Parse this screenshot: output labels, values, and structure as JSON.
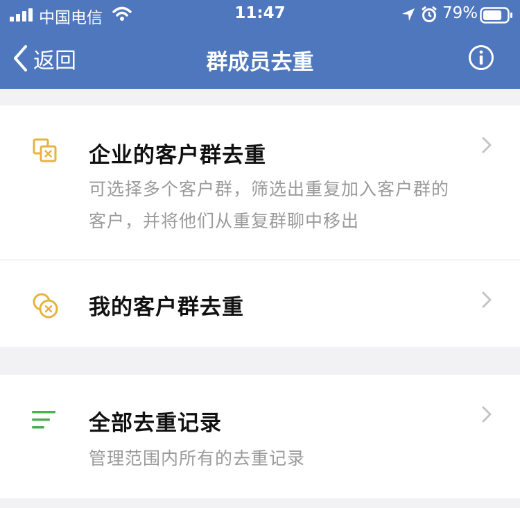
{
  "status_bar": {
    "carrier": "中国电信",
    "time": "11:47",
    "battery_percent": "79%",
    "battery_level": 0.79
  },
  "nav": {
    "back_label": "返回",
    "title": "群成员去重"
  },
  "rows": [
    {
      "title": "企业的客户群去重",
      "desc": "可选择多个客户群，筛选出重复加入客户群的客户，并将他们从重复群聊中移出",
      "icon": "overlap-squares-icon"
    },
    {
      "title": "我的客户群去重",
      "icon": "overlap-circles-icon"
    },
    {
      "title": "全部去重记录",
      "desc": "管理范围内所有的去重记录",
      "icon": "list-lines-icon"
    }
  ],
  "colors": {
    "header": "#4e77bd",
    "icon_yellow": "#e6b33e",
    "icon_green": "#4caf50",
    "desc_text": "#9a9a9a"
  }
}
